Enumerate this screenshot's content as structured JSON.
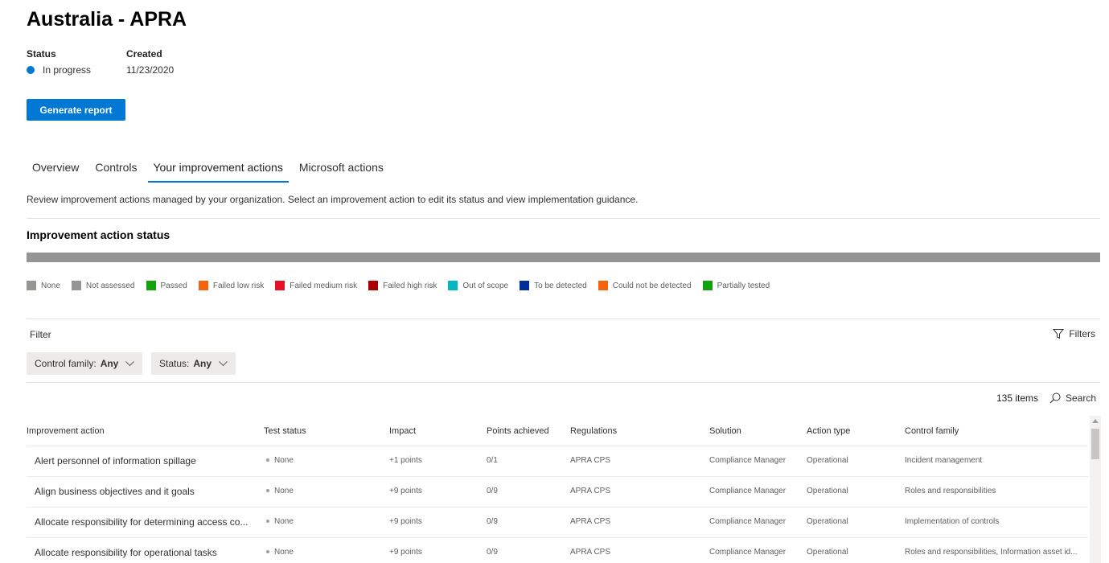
{
  "page": {
    "title": "Australia - APRA"
  },
  "meta": {
    "status_label": "Status",
    "status_value": "In progress",
    "status_color": "#0078d4",
    "created_label": "Created",
    "created_value": "11/23/2020"
  },
  "actions": {
    "generate_report": "Generate report"
  },
  "tabs": [
    {
      "label": "Overview",
      "active": false
    },
    {
      "label": "Controls",
      "active": false
    },
    {
      "label": "Your improvement actions",
      "active": true
    },
    {
      "label": "Microsoft actions",
      "active": false
    }
  ],
  "description": "Review improvement actions managed by your organization. Select an improvement action to edit its status and view implementation guidance.",
  "status_section": {
    "title": "Improvement action status",
    "bar_color": "#979593",
    "legend": [
      {
        "label": "None",
        "color": "#979593"
      },
      {
        "label": "Not assessed",
        "color": "#979593"
      },
      {
        "label": "Passed",
        "color": "#13a10e"
      },
      {
        "label": "Failed low risk",
        "color": "#f7630c"
      },
      {
        "label": "Failed medium risk",
        "color": "#e81123"
      },
      {
        "label": "Failed high risk",
        "color": "#a80000"
      },
      {
        "label": "Out of scope",
        "color": "#00b7c3"
      },
      {
        "label": "To be detected",
        "color": "#002d9c"
      },
      {
        "label": "Could not be detected",
        "color": "#f7630c"
      },
      {
        "label": "Partially tested",
        "color": "#13a10e"
      }
    ]
  },
  "filter": {
    "label": "Filter",
    "filters_button": "Filters",
    "pills": [
      {
        "key": "Control family:",
        "value": "Any"
      },
      {
        "key": "Status:",
        "value": "Any"
      }
    ]
  },
  "list": {
    "count": "135 items",
    "search_label": "Search",
    "columns": [
      "Improvement action",
      "Test status",
      "Impact",
      "Points achieved",
      "Regulations",
      "Solution",
      "Action type",
      "Control family"
    ],
    "rows": [
      {
        "action": "Alert personnel of information spillage",
        "status": "None",
        "impact": "+1 points",
        "points": "0/1",
        "regulations": "APRA CPS",
        "solution": "Compliance Manager",
        "type": "Operational",
        "family": "Incident management"
      },
      {
        "action": "Align business objectives and it goals",
        "status": "None",
        "impact": "+9 points",
        "points": "0/9",
        "regulations": "APRA CPS",
        "solution": "Compliance Manager",
        "type": "Operational",
        "family": "Roles and responsibilities"
      },
      {
        "action": "Allocate responsibility for determining access co...",
        "status": "None",
        "impact": "+9 points",
        "points": "0/9",
        "regulations": "APRA CPS",
        "solution": "Compliance Manager",
        "type": "Operational",
        "family": "Implementation of controls"
      },
      {
        "action": "Allocate responsibility for operational tasks",
        "status": "None",
        "impact": "+9 points",
        "points": "0/9",
        "regulations": "APRA CPS",
        "solution": "Compliance Manager",
        "type": "Operational",
        "family": "Roles and responsibilities, Information asset id..."
      }
    ]
  }
}
